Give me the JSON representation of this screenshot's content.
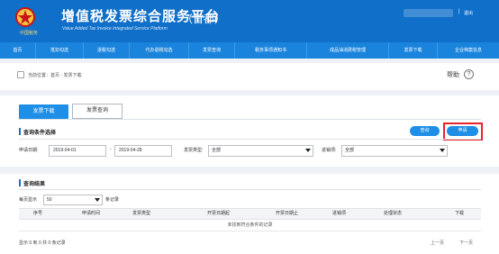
{
  "header": {
    "title": "增值税发票综合服务平台",
    "city": "（首都）",
    "subtitle": "Value Added Tax Invoice Integrated Service Platform",
    "logo_text": "中国税务",
    "separator": "|",
    "logout": "退出"
  },
  "nav": {
    "items": [
      "首页",
      "抵扣勾选",
      "退税勾选",
      "代办退税勾选",
      "发票查询",
      "税务事项通知书",
      "成品油消费税管理",
      "发票下载",
      "企业档案信息"
    ]
  },
  "breadcrumb": {
    "text": "当前位置：首页 - 发票下载",
    "help": "帮助",
    "help_icon": "?"
  },
  "tabs": {
    "download": "发票下载",
    "query": "发票查询"
  },
  "conditions": {
    "title": "查询条件选择",
    "search_button": "查询",
    "apply_button": "申请",
    "date_label": "申请日期:",
    "date_from": "2019-04-01",
    "date_sep": "-",
    "date_to": "2019-04-28",
    "invoice_type_label": "发票类型:",
    "invoice_type_value": "全部",
    "status_label": "进销项:",
    "status_value": "全部"
  },
  "results": {
    "title": "查询结果",
    "page_size_label": "每页显示",
    "page_size_value": "50",
    "page_size_suffix": "条记录",
    "columns": [
      "序号",
      "申请时间",
      "发票类型",
      "开票日期起",
      "开票日期止",
      "进销项",
      "处理状态",
      "下载"
    ],
    "empty_message": "未找到符合条件的记录",
    "footer_info": "显示 0 到 0 共 0 条记录",
    "prev": "上一页",
    "next": "下一页"
  },
  "colors": {
    "header_bg": "#0f6fc9",
    "nav_bg": "#1a84dd",
    "primary_button": "#1e8ee6",
    "highlight_frame": "#e8232a"
  }
}
